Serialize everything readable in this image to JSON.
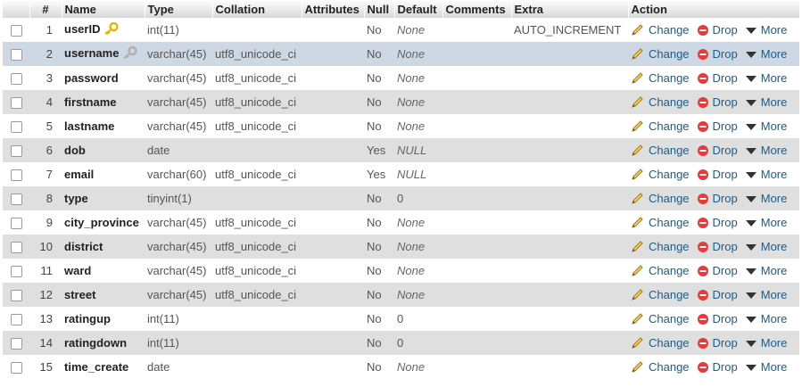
{
  "columns": {
    "num": "#",
    "name": "Name",
    "type": "Type",
    "collation": "Collation",
    "attributes": "Attributes",
    "null": "Null",
    "default": "Default",
    "comments": "Comments",
    "extra": "Extra",
    "action": "Action"
  },
  "actions": {
    "change": "Change",
    "drop": "Drop",
    "more": "More"
  },
  "rows": [
    {
      "num": "1",
      "name": "userID",
      "type": "int(11)",
      "collation": "",
      "attributes": "",
      "null": "No",
      "default": "None",
      "extra": "AUTO_INCREMENT",
      "key": "primary"
    },
    {
      "num": "2",
      "name": "username",
      "type": "varchar(45)",
      "collation": "utf8_unicode_ci",
      "attributes": "",
      "null": "No",
      "default": "None",
      "extra": "",
      "key": "unique"
    },
    {
      "num": "3",
      "name": "password",
      "type": "varchar(45)",
      "collation": "utf8_unicode_ci",
      "attributes": "",
      "null": "No",
      "default": "None",
      "extra": "",
      "key": ""
    },
    {
      "num": "4",
      "name": "firstname",
      "type": "varchar(45)",
      "collation": "utf8_unicode_ci",
      "attributes": "",
      "null": "No",
      "default": "None",
      "extra": "",
      "key": ""
    },
    {
      "num": "5",
      "name": "lastname",
      "type": "varchar(45)",
      "collation": "utf8_unicode_ci",
      "attributes": "",
      "null": "No",
      "default": "None",
      "extra": "",
      "key": ""
    },
    {
      "num": "6",
      "name": "dob",
      "type": "date",
      "collation": "",
      "attributes": "",
      "null": "Yes",
      "default": "NULL",
      "extra": "",
      "key": ""
    },
    {
      "num": "7",
      "name": "email",
      "type": "varchar(60)",
      "collation": "utf8_unicode_ci",
      "attributes": "",
      "null": "Yes",
      "default": "NULL",
      "extra": "",
      "key": ""
    },
    {
      "num": "8",
      "name": "type",
      "type": "tinyint(1)",
      "collation": "",
      "attributes": "",
      "null": "No",
      "default": "0",
      "extra": "",
      "key": ""
    },
    {
      "num": "9",
      "name": "city_province",
      "type": "varchar(45)",
      "collation": "utf8_unicode_ci",
      "attributes": "",
      "null": "No",
      "default": "None",
      "extra": "",
      "key": ""
    },
    {
      "num": "10",
      "name": "district",
      "type": "varchar(45)",
      "collation": "utf8_unicode_ci",
      "attributes": "",
      "null": "No",
      "default": "None",
      "extra": "",
      "key": ""
    },
    {
      "num": "11",
      "name": "ward",
      "type": "varchar(45)",
      "collation": "utf8_unicode_ci",
      "attributes": "",
      "null": "No",
      "default": "None",
      "extra": "",
      "key": ""
    },
    {
      "num": "12",
      "name": "street",
      "type": "varchar(45)",
      "collation": "utf8_unicode_ci",
      "attributes": "",
      "null": "No",
      "default": "None",
      "extra": "",
      "key": ""
    },
    {
      "num": "13",
      "name": "ratingup",
      "type": "int(11)",
      "collation": "",
      "attributes": "",
      "null": "No",
      "default": "0",
      "extra": "",
      "key": ""
    },
    {
      "num": "14",
      "name": "ratingdown",
      "type": "int(11)",
      "collation": "",
      "attributes": "",
      "null": "No",
      "default": "0",
      "extra": "",
      "key": ""
    },
    {
      "num": "15",
      "name": "time_create",
      "type": "date",
      "collation": "",
      "attributes": "",
      "null": "No",
      "default": "None",
      "extra": "",
      "key": ""
    }
  ],
  "highlighted_row": "2",
  "colors": {
    "link": "#235a81",
    "row_even": "#dfdfdf",
    "row_highlight": "#ced8e4",
    "primary_key": "#e8b400",
    "unique_key": "#b0b0b0",
    "drop_icon": "#e23d3d"
  },
  "icons": {
    "primary_key": "key-icon",
    "unique_key": "key-icon",
    "change": "pencil-icon",
    "drop": "drop-icon",
    "more": "triangle-down-icon"
  }
}
